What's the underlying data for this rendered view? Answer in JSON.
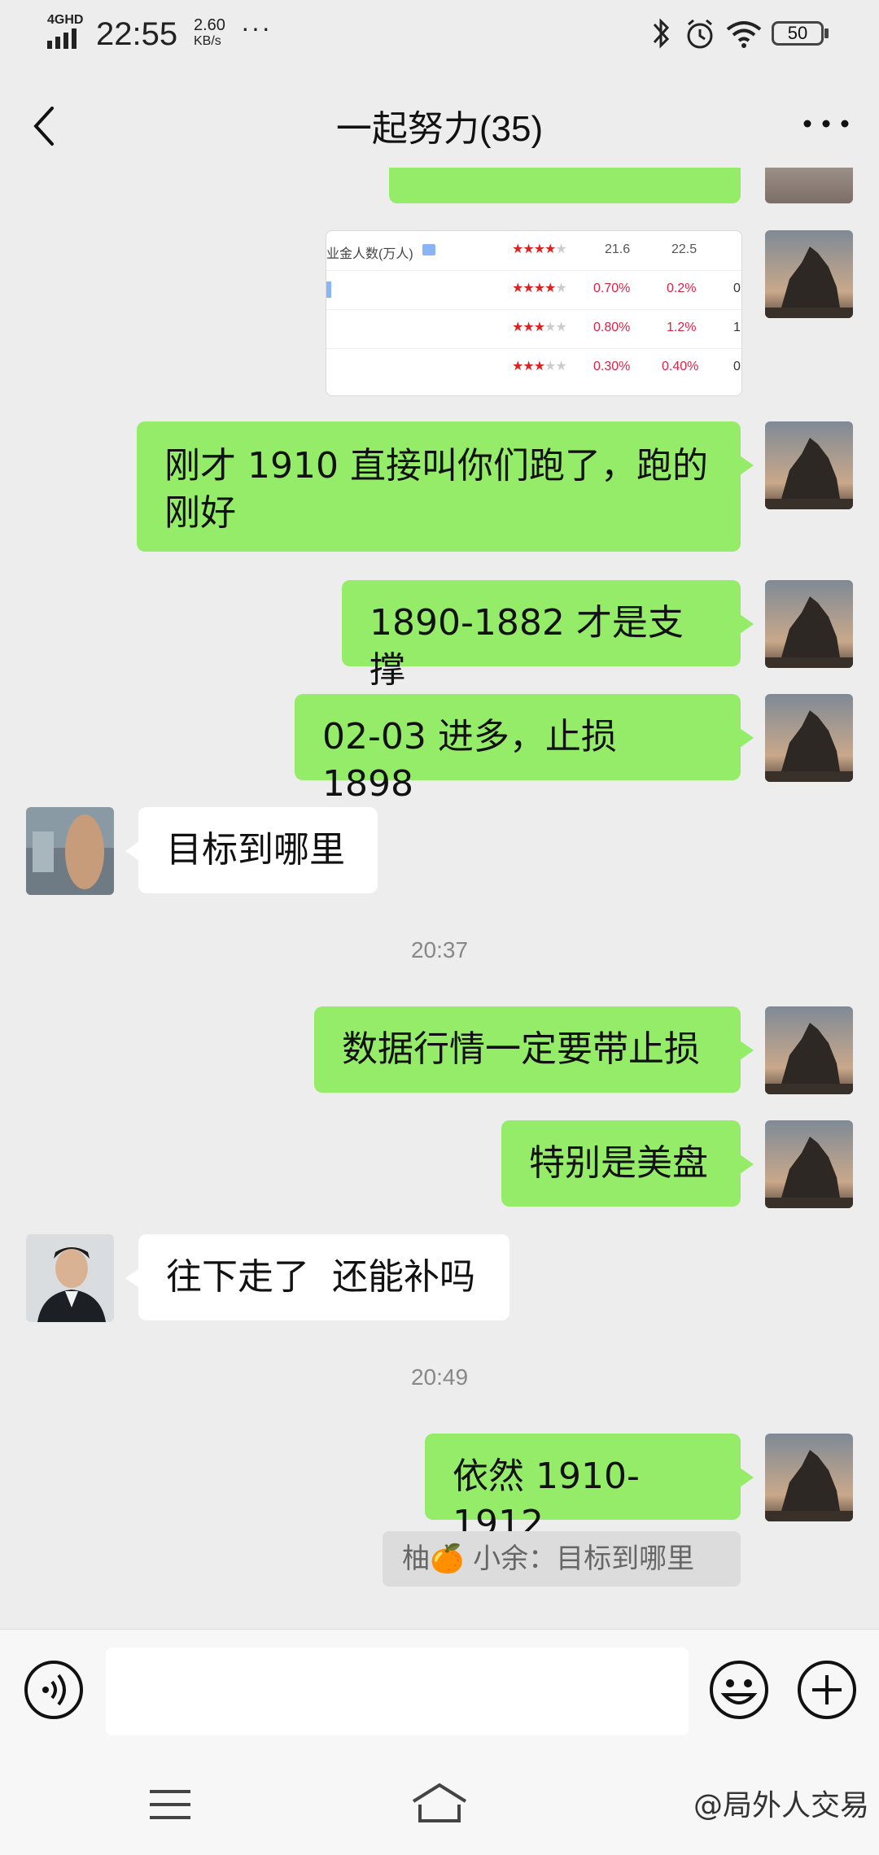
{
  "status_bar": {
    "network": "4GHD",
    "time": "22:55",
    "speed_value": "2.60",
    "speed_unit": "KB/s",
    "more": "···",
    "battery": "50"
  },
  "header": {
    "title": "一起努力(35)"
  },
  "shared_image": {
    "header_label": "业金人数(万人)",
    "rows": [
      {
        "stars_on": 4,
        "v1": "21.6",
        "v2": "22.5",
        "v3": ""
      },
      {
        "stars_on": 4,
        "v1": "0.70%",
        "v2": "0.2%",
        "v3": "0"
      },
      {
        "stars_on": 3,
        "v1": "0.80%",
        "v2": "1.2%",
        "v3": "1"
      },
      {
        "stars_on": 3,
        "v1": "0.30%",
        "v2": "0.40%",
        "v3": "0"
      }
    ]
  },
  "messages": {
    "m1": "刚才 1910 直接叫你们跑了，跑的",
    "m1b": "刚好",
    "m2": "1890-1882 才是支撑",
    "m3": "02-03 进多，止损 1898",
    "m4": "目标到哪里",
    "t1": "20:37",
    "m5": "数据行情一定要带止损",
    "m6": "特别是美盘",
    "m7": "往下走了  还能补吗",
    "t2": "20:49",
    "m8": "依然 1910-1912",
    "quote": "柚🍊 小余：目标到哪里"
  },
  "watermark": "@局外人交易",
  "colors": {
    "green_bubble": "#95ec69",
    "background": "#ededed",
    "white_bubble": "#ffffff"
  }
}
